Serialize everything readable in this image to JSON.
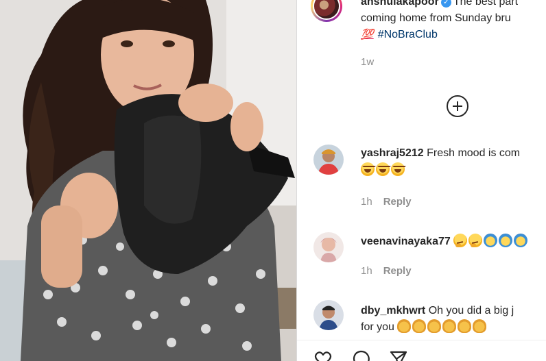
{
  "post": {
    "username": "anshulakapoor",
    "caption_line1": "The best part",
    "caption_line2": "coming home from Sunday bru",
    "caption_emoji": "💯",
    "hashtag": "#NoBraClub",
    "time": "1w"
  },
  "comments": [
    {
      "username": "yashraj5212",
      "text": "Fresh mood is com",
      "emojis": [
        "laugh",
        "laugh",
        "laugh"
      ],
      "time": "1h",
      "reply_label": "Reply"
    },
    {
      "username": "veenavinayaka77",
      "text": "",
      "emojis": [
        "think",
        "think",
        "raise",
        "raise",
        "raise"
      ],
      "time": "1h",
      "reply_label": "Reply"
    },
    {
      "username": "dby_mkhwrt",
      "text": "Oh you did a big j",
      "text_line2": "for you",
      "emojis": [
        "clap",
        "clap",
        "clap",
        "clap",
        "clap",
        "clap"
      ]
    }
  ],
  "actions": [
    "like-icon",
    "comment-icon",
    "share-icon"
  ],
  "colors": {
    "link": "#00376b",
    "muted": "#8e8e8e",
    "text": "#262626",
    "verified": "#3897f0"
  }
}
